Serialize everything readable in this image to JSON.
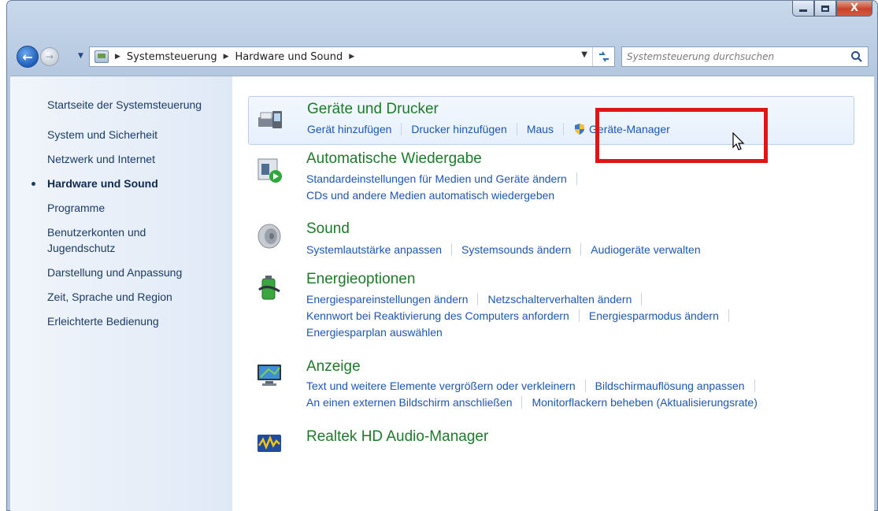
{
  "window": {
    "controls": {
      "minimize": "minimize",
      "maximize": "maximize",
      "close": "X"
    }
  },
  "nav": {
    "back": "←",
    "forward": "→",
    "breadcrumbs": [
      "Systemsteuerung",
      "Hardware und Sound"
    ],
    "search_placeholder": "Systemsteuerung durchsuchen"
  },
  "sidebar": {
    "home": "Startseite der Systemsteuerung",
    "items": [
      {
        "label": "System und Sicherheit",
        "active": false
      },
      {
        "label": "Netzwerk und Internet",
        "active": false
      },
      {
        "label": "Hardware und Sound",
        "active": true
      },
      {
        "label": "Programme",
        "active": false
      },
      {
        "label": "Benutzerkonten und\nJugendschutz",
        "active": false
      },
      {
        "label": "Darstellung und Anpassung",
        "active": false
      },
      {
        "label": "Zeit, Sprache und Region",
        "active": false
      },
      {
        "label": "Erleichterte Bedienung",
        "active": false
      }
    ]
  },
  "categories": [
    {
      "title": "Geräte und Drucker",
      "icon": "printer-icon",
      "rows": [
        [
          "Gerät hinzufügen",
          "Drucker hinzufügen",
          "Maus",
          "Geräte-Manager"
        ]
      ]
    },
    {
      "title": "Automatische Wiedergabe",
      "icon": "autoplay-icon",
      "rows": [
        [
          "Standardeinstellungen für Medien und Geräte ändern"
        ],
        [
          "CDs und andere Medien automatisch wiedergeben"
        ]
      ]
    },
    {
      "title": "Sound",
      "icon": "speaker-icon",
      "rows": [
        [
          "Systemlautstärke anpassen",
          "Systemsounds ändern",
          "Audiogeräte verwalten"
        ]
      ]
    },
    {
      "title": "Energieoptionen",
      "icon": "battery-icon",
      "rows": [
        [
          "Energiespareinstellungen ändern",
          "Netzschalterverhalten ändern"
        ],
        [
          "Kennwort bei Reaktivierung des Computers anfordern",
          "Energiesparmodus ändern"
        ],
        [
          "Energiesparplan auswählen"
        ]
      ]
    },
    {
      "title": "Anzeige",
      "icon": "monitor-icon",
      "rows": [
        [
          "Text und weitere Elemente vergrößern oder verkleinern",
          "Bildschirmauflösung anpassen"
        ],
        [
          "An einen externen Bildschirm anschließen",
          "Monitorflackern beheben (Aktualisierungsrate)"
        ]
      ]
    },
    {
      "title": "Realtek HD Audio-Manager",
      "icon": "realtek-audio-icon",
      "rows": []
    }
  ],
  "colors": {
    "category_title": "#1e7a2a",
    "link": "#1c56b5",
    "highlight_box": "#e01515"
  }
}
